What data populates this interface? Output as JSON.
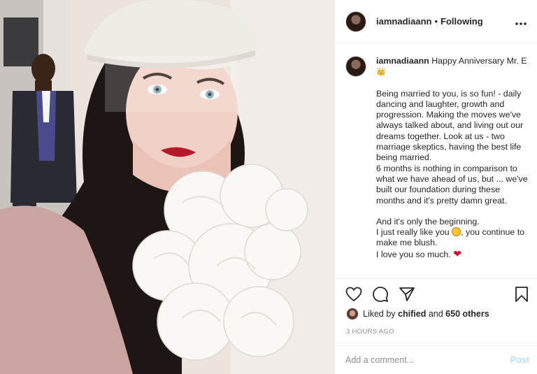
{
  "header": {
    "username": "iamnadiaann",
    "separator": "•",
    "follow_status": "Following",
    "more_icon": "more-dots-icon"
  },
  "caption": {
    "username": "iamnadiaann",
    "title": "Happy Anniversary Mr. E",
    "crown_emoji": "👑",
    "p1": "Being married to you, is so fun! - daily dancing and laughter, growth and progression. Making the moves we've always talked about, and living out our dreams together. Look at us - two marriage skeptics, having the best life being married.",
    "p2": "6 months is nothing in comparison to what we have ahead of us, but ... we've built our foundation during these months and it's pretty damn great.",
    "p3": "And it's only the beginning.",
    "p4a": "I just really like you",
    "p4b": ", you continue to make me blush.",
    "p5": "I love you so much.",
    "heart_emoji": "❤"
  },
  "actions": {
    "like_icon": "heart-icon",
    "comment_icon": "comment-icon",
    "share_icon": "share-icon",
    "save_icon": "bookmark-icon"
  },
  "likes": {
    "prefix": "Liked by",
    "user": "chified",
    "and": "and",
    "others": "650 others"
  },
  "timestamp": "3 HOURS AGO",
  "comment": {
    "placeholder": "Add a comment...",
    "post_label": "Post"
  },
  "colors": {
    "text": "#262626",
    "muted": "#8e8e8e",
    "post_disabled": "#b2dffc",
    "heart": "#d10f2b"
  }
}
